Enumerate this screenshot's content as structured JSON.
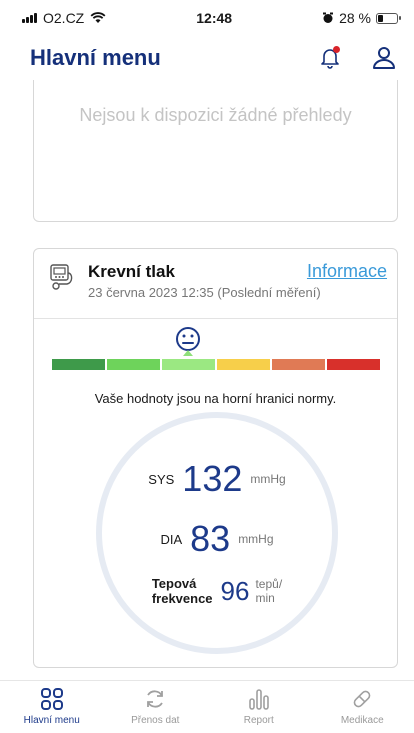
{
  "status_bar": {
    "carrier": "O2.CZ",
    "time": "12:48",
    "battery": "28 %"
  },
  "header": {
    "title": "Hlavní menu"
  },
  "overview_card": {
    "empty_text": "Nejsou k dispozici žádné přehledy"
  },
  "bp_card": {
    "title": "Krevní tlak",
    "subtitle": "23 června 2023 12:35 (Poslední měření)",
    "info_link": "Informace",
    "scale_colors": [
      "#3e9a4a",
      "#6ed35b",
      "#9be882",
      "#f7cf4a",
      "#e07a55",
      "#d8302b"
    ],
    "scale_level_index": 2,
    "message": "Vaše hodnoty jsou na horní hranici normy.",
    "sys_label": "SYS",
    "sys_value": "132",
    "sys_unit": "mmHg",
    "dia_label": "DIA",
    "dia_value": "83",
    "dia_unit": "mmHg",
    "pulse_label_line1": "Tepová",
    "pulse_label_line2": "frekvence",
    "pulse_value": "96",
    "pulse_unit_line1": "tepů/",
    "pulse_unit_line2": "min"
  },
  "tabbar": {
    "tabs": [
      {
        "label": "Hlavní menu",
        "icon": "grid-icon",
        "active": true
      },
      {
        "label": "Přenos dat",
        "icon": "sync-icon",
        "active": false
      },
      {
        "label": "Report",
        "icon": "chart-icon",
        "active": false
      },
      {
        "label": "Medikace",
        "icon": "pill-icon",
        "active": false
      }
    ]
  },
  "colors": {
    "primary": "#15307a",
    "link": "#3a9ad9"
  }
}
